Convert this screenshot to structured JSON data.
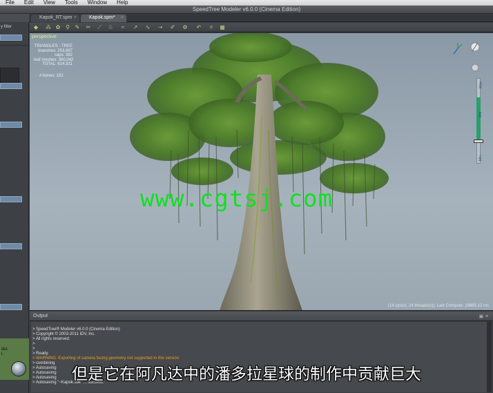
{
  "menubar": {
    "items": [
      "File",
      "Edit",
      "View",
      "Tools",
      "Window",
      "Help"
    ]
  },
  "window": {
    "title": "SpeedTree Modeler v6.0.0 (Cinema Edition)"
  },
  "left_panel": {
    "filter_label": "y filter",
    "thumb_text": "del.",
    "thumb_text2": "l."
  },
  "tabs": [
    {
      "label": "Kapok_RT.spm"
    },
    {
      "label": "Kapok.spm*"
    }
  ],
  "viewport": {
    "label": "perspective",
    "stats_title": "TRIANGLES - TREE",
    "stats": [
      "branches: 253,897",
      "caps: 382",
      "leaf meshes: 360,042",
      "TOTAL: 614,321"
    ],
    "bones": "# bones: 152",
    "status": "(14 cps(s), 24 threads(s)), Last Compute: 19865.12 ms",
    "watermark": "www.cgtsj.com",
    "slider_top_label": "Max",
    "slider_mid_label": "Mid",
    "slider_bottom_label": "Min"
  },
  "output": {
    "title": "Output",
    "lines": [
      {
        "text": "> SpeedTree® Modeler v6.0.0 (Cinema Edition)",
        "warn": false
      },
      {
        "text": "> Copyright © 2003-2011 IDV, Inc.",
        "warn": false
      },
      {
        "text": "> All rights reserved.",
        "warn": false
      },
      {
        "text": ">",
        "warn": false
      },
      {
        "text": ">",
        "warn": false
      },
      {
        "text": "> Ready.",
        "warn": false
      },
      {
        "text": "> WARNING: Exporting of camera facing geometry not supported in this version",
        "warn": true
      },
      {
        "text": "> combining",
        "warn": false
      },
      {
        "text": "> Autosaving",
        "warn": false
      },
      {
        "text": "> Autosaving",
        "warn": false
      },
      {
        "text": "> Autosaving",
        "warn": false
      },
      {
        "text": "> Autosaving \"~Kapok.sbk\" ... success.",
        "warn": false
      }
    ]
  },
  "subtitle": "但是它在阿凡达中的潘多拉星球的制作中贡献巨大"
}
